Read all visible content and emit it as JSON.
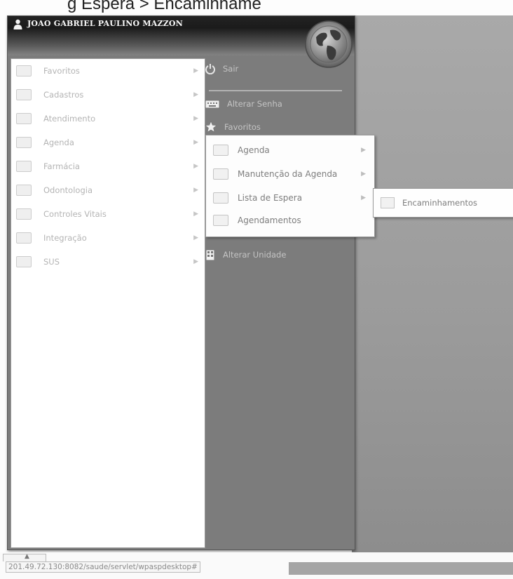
{
  "document": {
    "title_fragment": "g  Espera > Encaminhame"
  },
  "user": {
    "name": "JOAO GABRIEL PAULINO MAZZON"
  },
  "left_menu": {
    "items": [
      {
        "label": "Favoritos",
        "arrow": "▶"
      },
      {
        "label": "Cadastros",
        "arrow": "▶"
      },
      {
        "label": "Atendimento",
        "arrow": "▶"
      },
      {
        "label": "Agenda",
        "arrow": "▶"
      },
      {
        "label": "Farmácia",
        "arrow": "▶"
      },
      {
        "label": "Odontologia",
        "arrow": "▶"
      },
      {
        "label": "Controles Vitais",
        "arrow": "▶"
      },
      {
        "label": "Integração",
        "arrow": "▶"
      },
      {
        "label": "SUS",
        "arrow": "▶"
      }
    ]
  },
  "right_menu": {
    "items": [
      {
        "label": "Sair",
        "icon": "power-icon"
      },
      {
        "label": "Alterar Senha",
        "icon": "keyboard-icon"
      },
      {
        "label": "Favoritos",
        "icon": "star-icon"
      },
      {
        "label": "Alterar Unidade",
        "icon": "building-icon"
      }
    ]
  },
  "agenda_submenu": {
    "items": [
      {
        "label": "Agenda",
        "arrow": "▶"
      },
      {
        "label": "Manutenção da Agenda",
        "arrow": "▶"
      },
      {
        "label": "Lista de Espera",
        "arrow": "▶"
      },
      {
        "label": "Agendamentos",
        "arrow": ""
      }
    ]
  },
  "lista_espera_submenu": {
    "items": [
      {
        "label": "Encaminhamentos"
      }
    ]
  },
  "status_bar": {
    "url": "201.49.72.130:8082/saude/servlet/wpaspdesktop#",
    "up_arrow": "▲"
  }
}
